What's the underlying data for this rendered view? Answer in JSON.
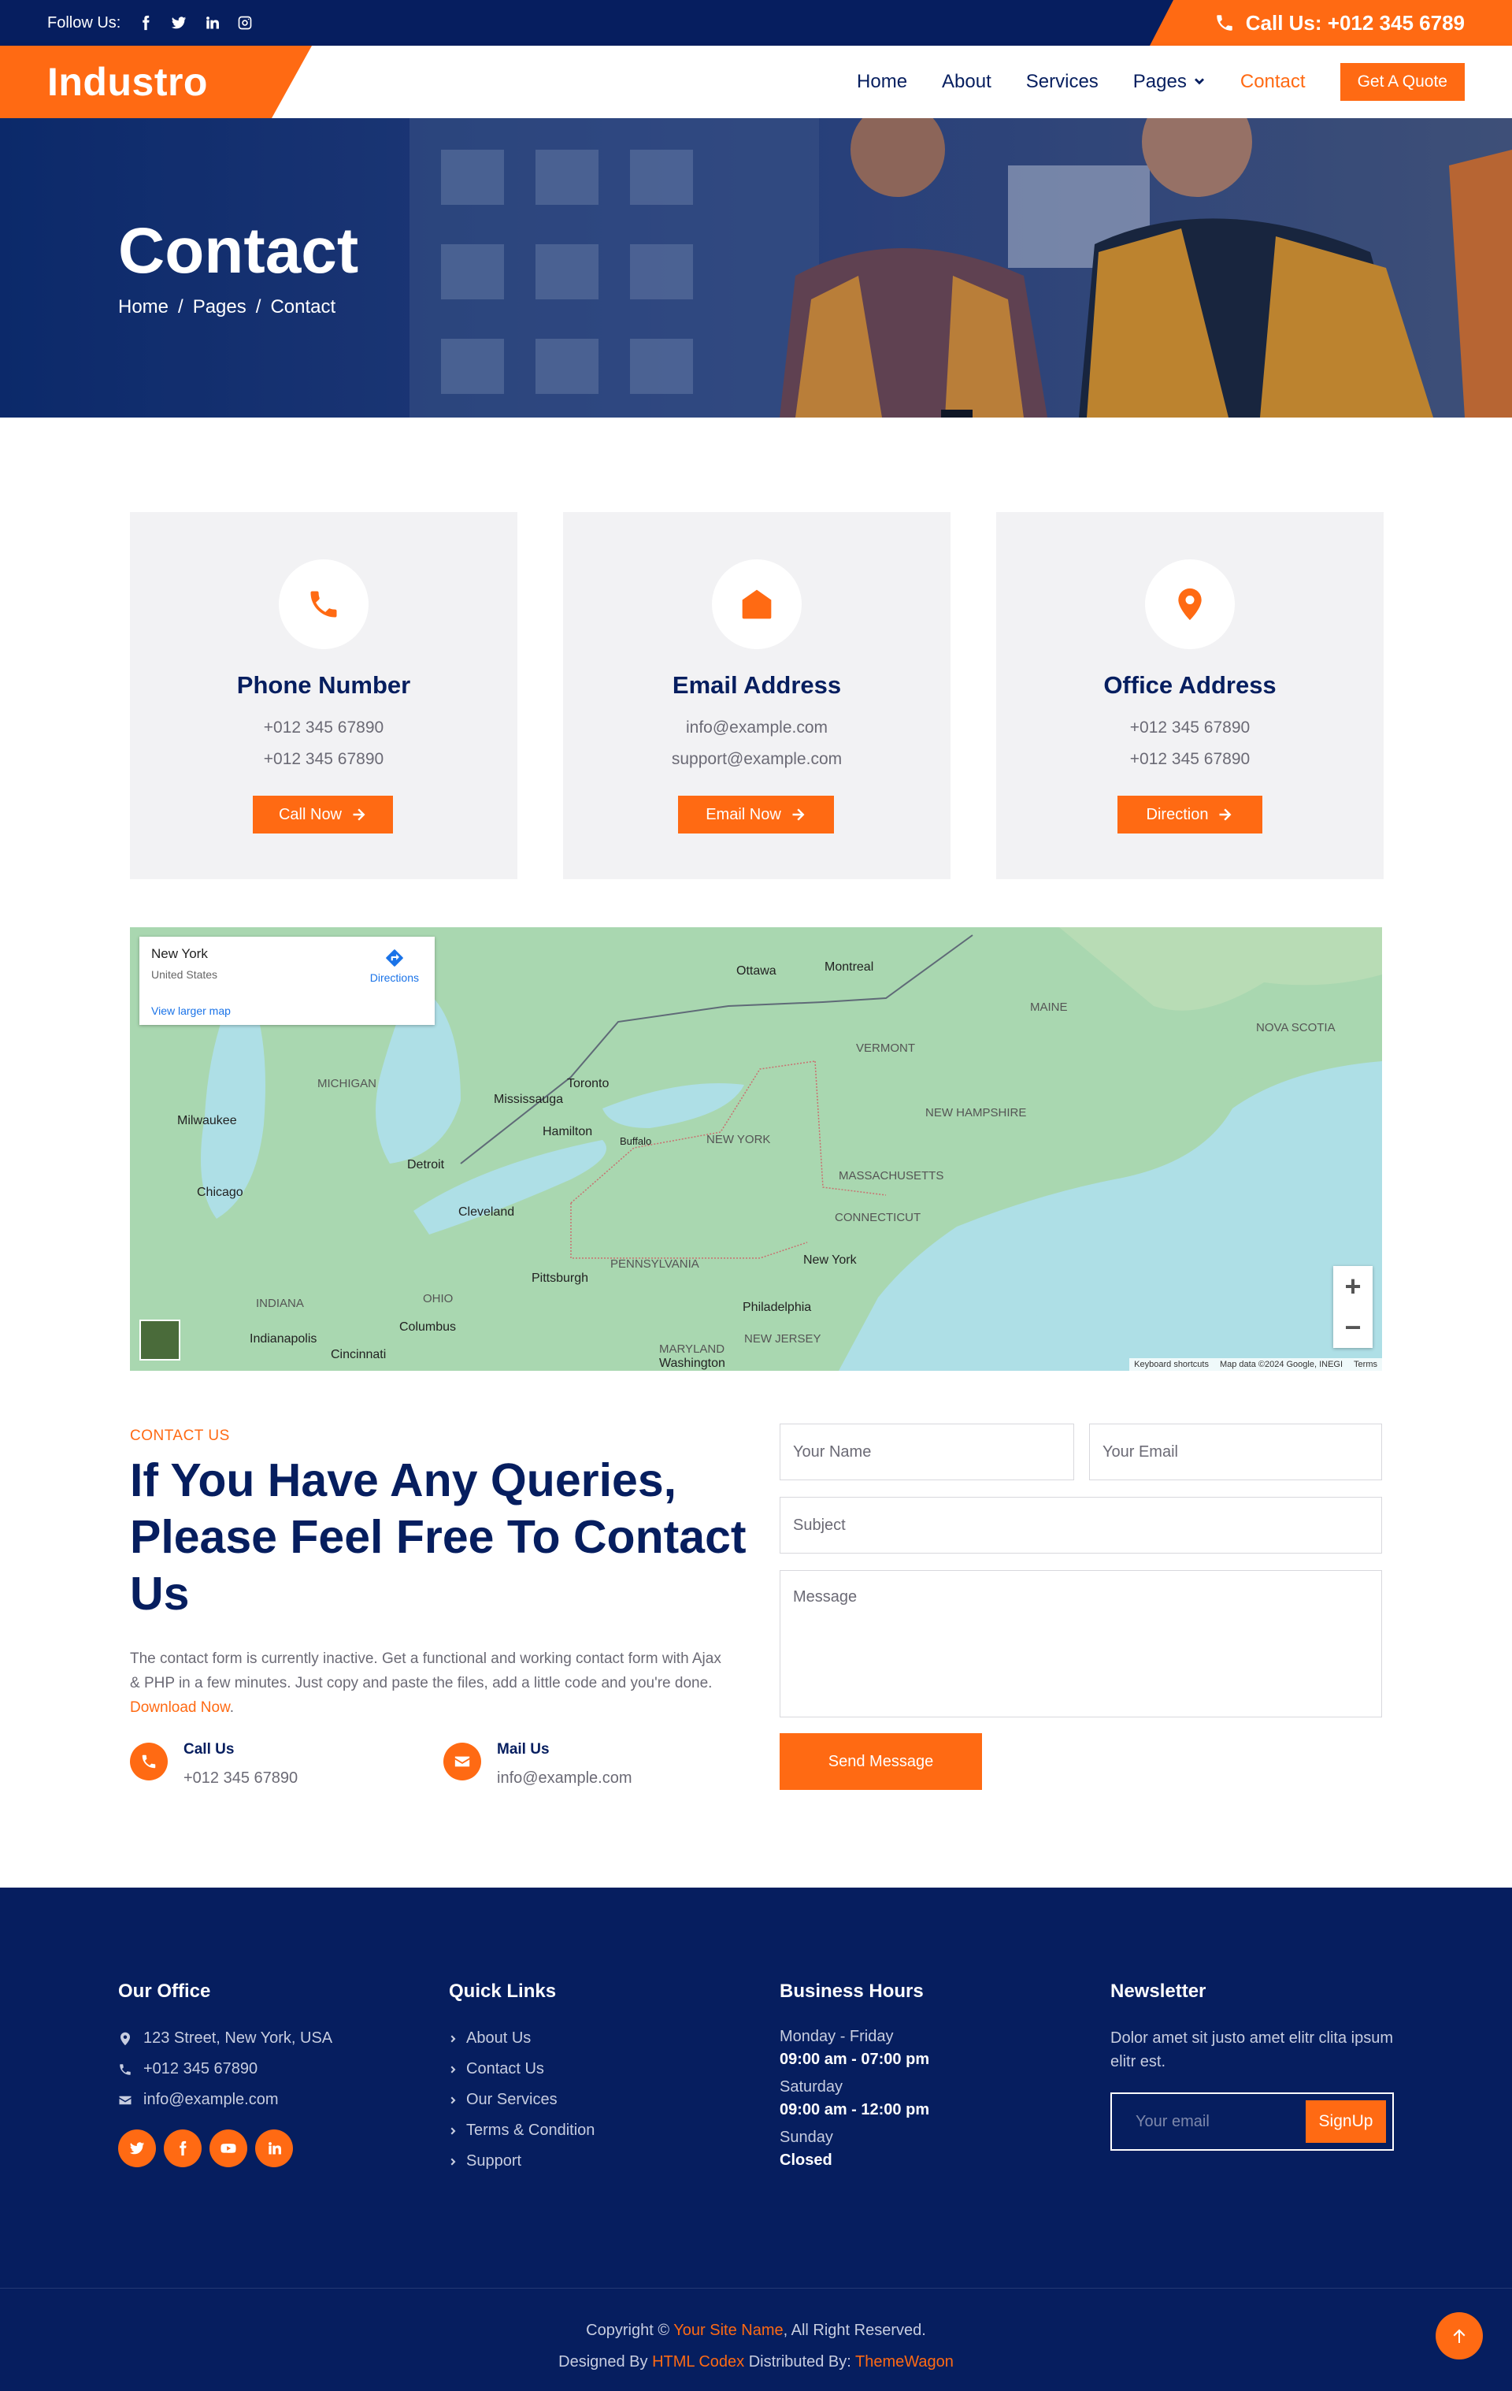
{
  "topbar": {
    "follow_label": "Follow Us:",
    "call_label": "Call Us: +012 345 6789"
  },
  "brand": {
    "name": "Industro"
  },
  "nav": {
    "items": [
      "Home",
      "About",
      "Services",
      "Pages",
      "Contact"
    ],
    "active": "Contact",
    "quote_button": "Get A Quote"
  },
  "hero": {
    "title": "Contact",
    "breadcrumb": [
      "Home",
      "/",
      "Pages",
      "/",
      "Contact"
    ]
  },
  "cards": [
    {
      "title": "Phone Number",
      "line1": "+012 345 67890",
      "line2": "+012 345 67890",
      "button": "Call Now",
      "icon": "phone-icon"
    },
    {
      "title": "Email Address",
      "line1": "info@example.com",
      "line2": "support@example.com",
      "button": "Email Now",
      "icon": "envelope-open-icon"
    },
    {
      "title": "Office Address",
      "line1": "+012 345 67890",
      "line2": "+012 345 67890",
      "button": "Direction",
      "icon": "map-marker-icon"
    }
  ],
  "map": {
    "place": "New York",
    "country": "United States",
    "directions": "Directions",
    "larger": "View larger map",
    "zoom_in": "+",
    "zoom_out": "−",
    "credits": [
      "Keyboard shortcuts",
      "Map data ©2024 Google, INEGI",
      "Terms"
    ],
    "labels": {
      "ottawa": "Ottawa",
      "montreal": "Montreal",
      "maine": "MAINE",
      "vermont": "VERMONT",
      "newhampshire": "NEW HAMPSHIRE",
      "newyork": "NEW YORK",
      "massachusetts": "MASSACHUSETTS",
      "connecticut": "CONNECTICUT",
      "pennsylvania": "PENNSYLVANIA",
      "ohio": "OHIO",
      "michigan": "MICHIGAN",
      "indiana": "INDIANA",
      "toronto": "Toronto",
      "detroit": "Detroit",
      "cleveland": "Cleveland",
      "chicago": "Chicago",
      "milwaukee": "Milwaukee",
      "pittsburgh": "Pittsburgh",
      "philadelphia": "Philadelphia",
      "newyorkcity": "New York",
      "washington": "Washington",
      "novascotia": "NOVA SCOTIA",
      "mississauga": "Mississauga",
      "hamilton": "Hamilton",
      "buffalo": "Buffalo",
      "indianapolis": "Indianapolis",
      "columbus": "Columbus",
      "newjersey": "NEW JERSEY",
      "maryland": "MARYLAND",
      "cincinnati": "Cincinnati"
    }
  },
  "contact": {
    "eyebrow": "CONTACT US",
    "heading": "If You Have Any Queries, Please Feel Free To Contact Us",
    "paragraph": "The contact form is currently inactive. Get a functional and working contact form with Ajax & PHP in a few minutes. Just copy and paste the files, add a little code and you're done.",
    "download_link": "Download Now",
    "call_title": "Call Us",
    "call_value": "+012 345 67890",
    "mail_title": "Mail Us",
    "mail_value": "info@example.com"
  },
  "form": {
    "name_placeholder": "Your Name",
    "email_placeholder": "Your Email",
    "subject_placeholder": "Subject",
    "message_placeholder": "Message",
    "submit": "Send Message"
  },
  "footer": {
    "office_title": "Our Office",
    "address": "123 Street, New York, USA",
    "phone": "+012 345 67890",
    "email": "info@example.com",
    "links_title": "Quick Links",
    "links": [
      "About Us",
      "Contact Us",
      "Our Services",
      "Terms & Condition",
      "Support"
    ],
    "hours_title": "Business Hours",
    "hours": [
      {
        "label": "Monday - Friday",
        "value": "09:00 am - 07:00 pm"
      },
      {
        "label": "Saturday",
        "value": "09:00 am - 12:00 pm"
      },
      {
        "label": "Sunday",
        "value": "Closed"
      }
    ],
    "newsletter_title": "Newsletter",
    "newsletter_text": "Dolor amet sit justo amet elitr clita ipsum elitr est.",
    "newsletter_placeholder": "Your email",
    "signup": "SignUp",
    "copyright_prefix": "Copyright ©",
    "site_name": "Your Site Name",
    "copyright_suffix": ", All Right Reserved.",
    "designed_by": "Designed By",
    "codex": "HTML Codex",
    "distributed_by": "Distributed By:",
    "themewagon": "ThemeWagon"
  },
  "colors": {
    "primary": "#ff6a13",
    "navy": "#061e5f",
    "card_bg": "#f2f2f4"
  }
}
